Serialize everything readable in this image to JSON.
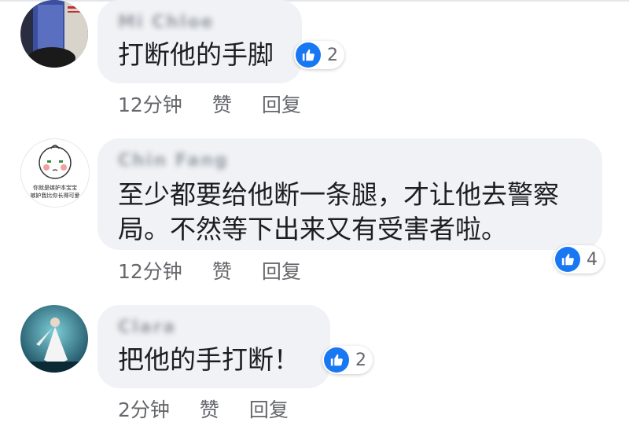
{
  "comments": [
    {
      "author": "Mi Chloe",
      "text": "打断他的手脚",
      "reaction": {
        "icon": "thumbs-up-icon",
        "count": "2"
      },
      "time": "12分钟",
      "like_label": "赞",
      "reply_label": "回复"
    },
    {
      "author": "Chin Fang",
      "text_lines": [
        "至少都要给他断一条腿，才让他去警察",
        "局。不然等下出来又有受害者啦。"
      ],
      "reaction": {
        "icon": "thumbs-up-icon",
        "count": "4"
      },
      "time": "12分钟",
      "like_label": "赞",
      "reply_label": "回复",
      "avatar_caption_lines": [
        "你就是嫉妒本宝宝",
        "嫉妒我比你长得可爱"
      ]
    },
    {
      "author": "Clara",
      "text": "把他的手打断！",
      "reaction": {
        "icon": "thumbs-up-icon",
        "count": "2"
      },
      "time": "2分钟",
      "like_label": "赞",
      "reply_label": "回复"
    }
  ],
  "colors": {
    "like_blue": "#1877f2",
    "bubble_bg": "#f0f2f5",
    "meta_text": "#65676b"
  }
}
